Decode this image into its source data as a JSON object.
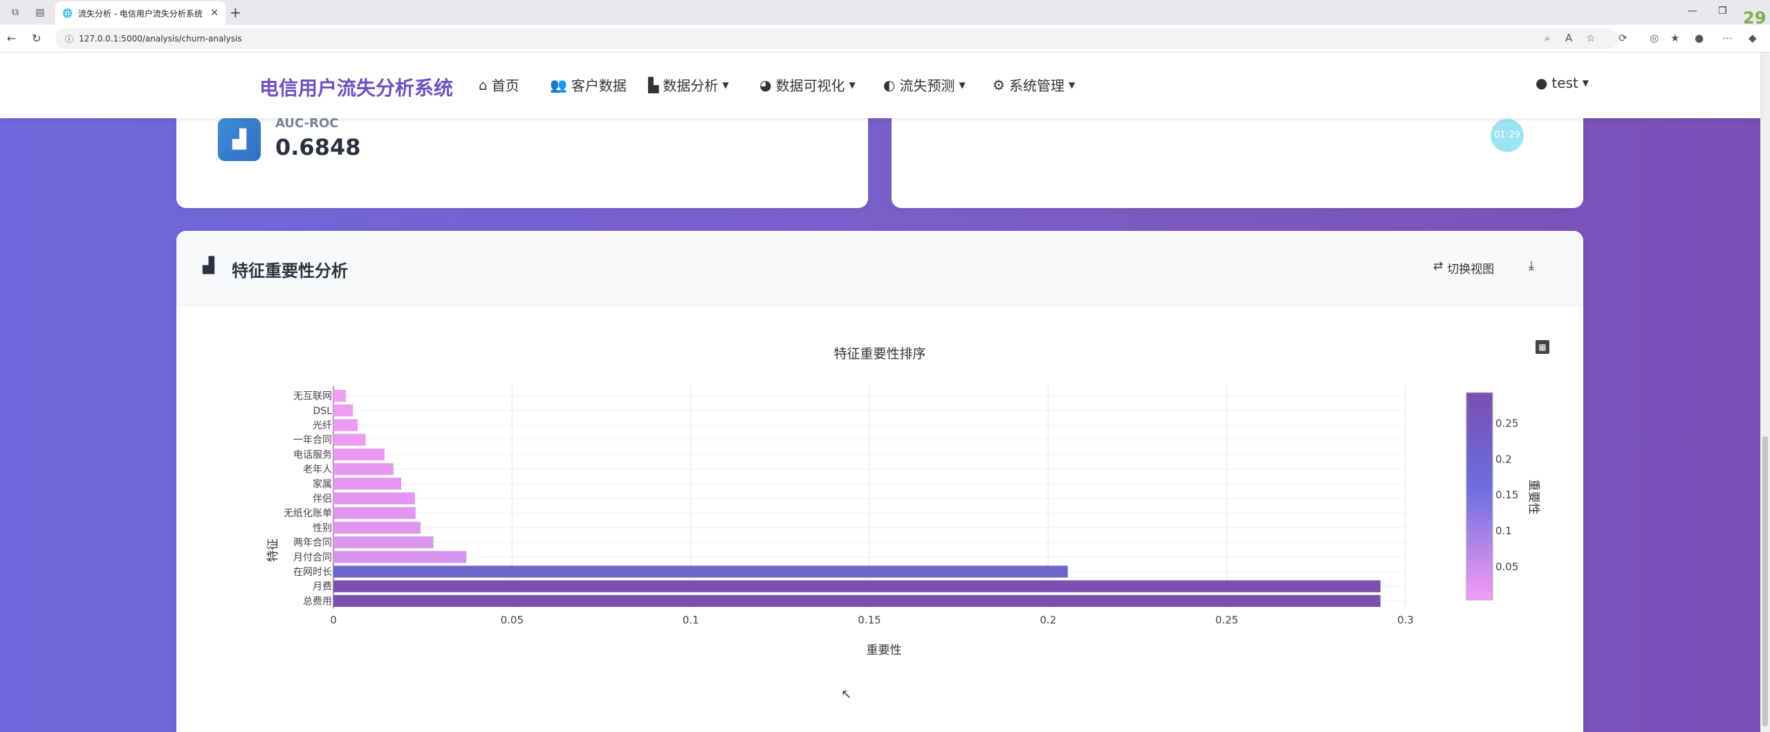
{
  "browser": {
    "tab_title": "流失分析 - 电信用户流失分析系统",
    "url": "127.0.0.1:5000/analysis/churn-analysis",
    "badge": "29"
  },
  "navbar": {
    "brand": "电信用户流失分析系统",
    "items": [
      {
        "label": "首页",
        "icon": "home-icon",
        "dropdown": false
      },
      {
        "label": "客户数据",
        "icon": "users-icon",
        "dropdown": false
      },
      {
        "label": "数据分析",
        "icon": "chart-line-icon",
        "dropdown": true
      },
      {
        "label": "数据可视化",
        "icon": "pie-icon",
        "dropdown": true
      },
      {
        "label": "流失预测",
        "icon": "brain-icon",
        "dropdown": true
      },
      {
        "label": "系统管理",
        "icon": "gear-icon",
        "dropdown": true
      }
    ],
    "user": "test"
  },
  "metric": {
    "label": "AUC-ROC",
    "value": "0.6848"
  },
  "timer": "01:29",
  "feature_section": {
    "title": "特征重要性分析",
    "switch_label": "切换视图"
  },
  "chart_data": {
    "type": "bar",
    "orientation": "horizontal",
    "title": "特征重要性排序",
    "xlabel": "重要性",
    "ylabel": "特征",
    "xlim": [
      0,
      0.3
    ],
    "xticks": [
      0,
      0.05,
      0.1,
      0.15,
      0.2,
      0.25,
      0.3
    ],
    "categories": [
      "无互联网",
      "DSL",
      "光纤",
      "一年合同",
      "电话服务",
      "老年人",
      "家属",
      "伴侣",
      "无纸化账单",
      "性别",
      "两年合同",
      "月付合同",
      "在网时长",
      "月费",
      "总费用"
    ],
    "values": [
      0.0035,
      0.0055,
      0.0068,
      0.009,
      0.0143,
      0.0168,
      0.019,
      0.0228,
      0.023,
      0.0244,
      0.028,
      0.0372,
      0.2055,
      0.293,
      0.293
    ],
    "colorbar": {
      "title": "重要性",
      "ticks": [
        0.05,
        0.1,
        0.15,
        0.2,
        0.25
      ],
      "range": [
        0.0035,
        0.293
      ],
      "colors": [
        "#f29cf4",
        "#6a6edc",
        "#7a4fb0"
      ]
    },
    "grid": true
  }
}
